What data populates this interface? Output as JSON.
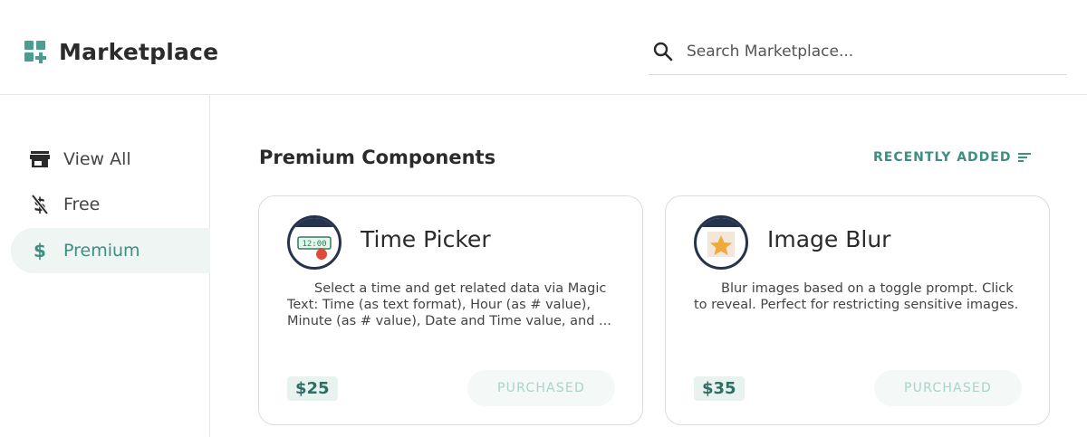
{
  "header": {
    "title": "Marketplace",
    "brand_icon": "marketplace-add-icon",
    "search": {
      "placeholder": "Search Marketplace...",
      "value": "",
      "icon": "search-icon"
    }
  },
  "sidebar": {
    "items": [
      {
        "label": "View All",
        "icon": "store-icon",
        "active": false
      },
      {
        "label": "Free",
        "icon": "no-dollar-icon",
        "active": false
      },
      {
        "label": "Premium",
        "icon": "dollar-icon",
        "active": true
      }
    ]
  },
  "main": {
    "section_title": "Premium Components",
    "sort_label": "RECENTLY ADDED",
    "sort_icon": "sort-icon",
    "cards": [
      {
        "title": "Time Picker",
        "logo_icon": "time-picker-icon",
        "description": "Select a time and get related data via Magic Text: Time (as text format), Hour (as # value), Minute (as # value), Date and Time value, and ...",
        "price": "$25",
        "status_label": "PURCHASED"
      },
      {
        "title": "Image Blur",
        "logo_icon": "star-image-icon",
        "description": "Blur images based on a toggle prompt. Click to reveal. Perfect for restricting sensitive images.",
        "price": "$35",
        "status_label": "PURCHASED"
      }
    ]
  },
  "colors": {
    "accent": "#3d8f81",
    "brand": "#4a9d8f",
    "active_bg": "#eef5f3",
    "price_bg": "#e8f2ef",
    "logo_navy": "#26334d"
  }
}
